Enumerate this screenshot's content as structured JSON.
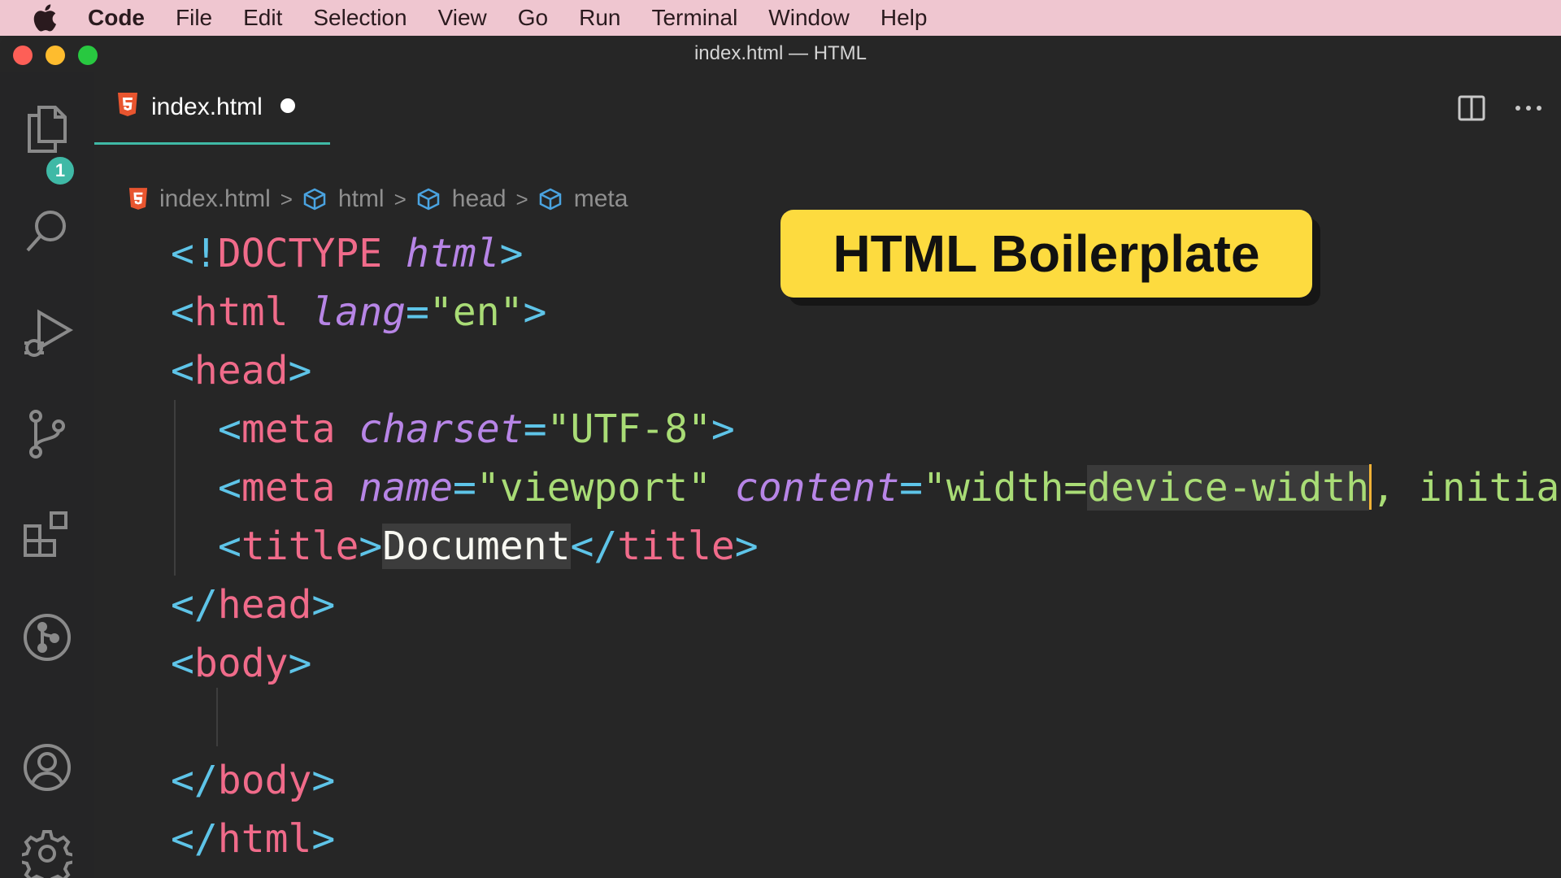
{
  "menubar": {
    "app": "Code",
    "items": [
      "File",
      "Edit",
      "Selection",
      "View",
      "Go",
      "Run",
      "Terminal",
      "Window",
      "Help"
    ]
  },
  "window": {
    "title": "index.html — HTML"
  },
  "activity_bar": {
    "explorer_badge": "1",
    "icons": [
      "files-icon",
      "search-icon",
      "run-debug-icon",
      "source-control-icon",
      "extensions-icon",
      "git-graph-icon",
      "account-icon",
      "settings-gear-icon"
    ]
  },
  "tab": {
    "label": "index.html",
    "modified": true
  },
  "breadcrumb": [
    "index.html",
    "html",
    "head",
    "meta"
  ],
  "code": {
    "l1": {
      "open": "<!",
      "kw": "DOCTYPE",
      "attr": "html",
      "close": ">"
    },
    "l2": {
      "tag": "html",
      "attr": "lang",
      "value": "\"en\""
    },
    "l3": {
      "tag": "head"
    },
    "l4": {
      "tag": "meta",
      "attr": "charset",
      "value": "\"UTF-8\""
    },
    "l5": {
      "tag": "meta",
      "attr1": "name",
      "value1": "\"viewport\"",
      "attr2": "content",
      "value2_a": "\"width=",
      "value2_b": "device-width",
      "value2_c": ", initia"
    },
    "l6": {
      "tag": "title",
      "text": "Document"
    },
    "l7": {
      "tag": "head"
    },
    "l8": {
      "tag": "body"
    },
    "l10": {
      "tag": "body"
    },
    "l11": {
      "tag": "html"
    }
  },
  "overlay": {
    "label": "HTML Boilerplate"
  },
  "colors": {
    "menubar": "#efc6d0",
    "editor_bg": "#262626",
    "accent": "#3fb9a6",
    "tag": "#f06b8a",
    "punct": "#5ec4e8",
    "attr": "#b785e6",
    "string": "#a9dc76",
    "overlay": "#fddb3f"
  }
}
